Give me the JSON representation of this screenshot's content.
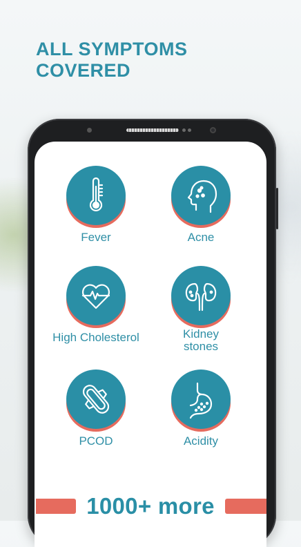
{
  "headline": {
    "line1": "ALL SYMPTOMS",
    "line2": "COVERED"
  },
  "colors": {
    "teal": "#2a8fa6",
    "coral": "#e66b5e",
    "headline": "#2f8fa6"
  },
  "symptoms": [
    {
      "label": "Fever",
      "icon": "thermometer-icon"
    },
    {
      "label": "Acne",
      "icon": "face-acne-icon"
    },
    {
      "label": "High Cholesterol",
      "icon": "heart-pulse-icon"
    },
    {
      "label": "Kidney stones",
      "icon": "kidneys-icon"
    },
    {
      "label": "PCOD",
      "icon": "sanitary-pad-icon"
    },
    {
      "label": "Acidity",
      "icon": "stomach-icon"
    }
  ],
  "banner": {
    "text": "1000+ more"
  }
}
